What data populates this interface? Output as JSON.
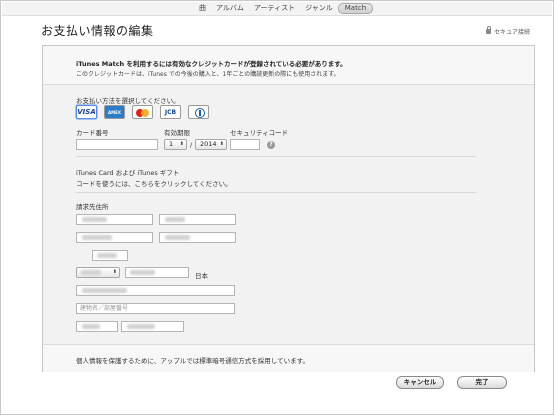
{
  "tabs": [
    {
      "label": "曲"
    },
    {
      "label": "アルバム"
    },
    {
      "label": "アーティスト"
    },
    {
      "label": "ジャンル"
    },
    {
      "label": "Match",
      "active": true
    }
  ],
  "page": {
    "title": "お支払い情報の編集",
    "secure_label": "セキュア接続"
  },
  "notice": {
    "bold": "iTunes Match を利用するには有効なクレジットカードが登録されている必要があります。",
    "sub": "このクレジットカードは、iTunes での今後の購入と、1年ごとの購読更新の際にも使用されます。"
  },
  "payment": {
    "method_label": "お支払い方法を選択してください。",
    "cards": [
      {
        "name": "VISA",
        "selected": true
      },
      {
        "name": "AMEX"
      },
      {
        "name": "MasterCard"
      },
      {
        "name": "JCB"
      },
      {
        "name": "Diners Club"
      }
    ],
    "card_number_label": "カード番号",
    "expiry_label": "有効期限",
    "expiry_month": "1",
    "expiry_separator": "/",
    "expiry_year": "2014",
    "security_code_label": "セキュリティコード",
    "help_glyph": "?"
  },
  "gift": {
    "line1": "iTunes Card および iTunes ギフト",
    "line2": "コードを使うには、こちらをクリックしてください。"
  },
  "billing": {
    "title": "請求先住所",
    "country": "日本",
    "building_placeholder": "建物名／部屋番号"
  },
  "footer": {
    "privacy_text": "個人情報を保護するために、アップルでは標準暗号通信方式を採用しています。"
  },
  "buttons": {
    "cancel": "キャンセル",
    "done": "完了"
  }
}
